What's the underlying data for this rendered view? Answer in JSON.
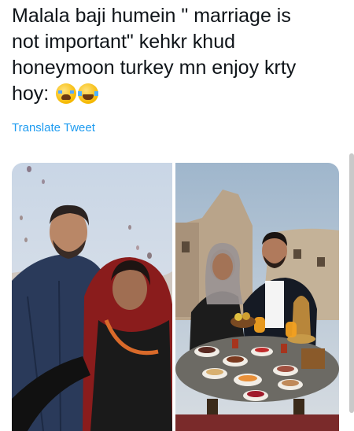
{
  "tweet": {
    "lines": [
      "Malala baji humein \" marriage is",
      "not important\" kehkr khud",
      "honeymoon turkey mn enjoy krty",
      "hoy:"
    ],
    "emojis": [
      "loudly-crying-face-emoji",
      "face-with-tears-of-joy-emoji"
    ]
  },
  "translate_link": "Translate Tweet",
  "media": {
    "left_photo": "couple-balloon-ride-photo",
    "right_photo": "couple-cappadocia-breakfast-photo"
  },
  "colors": {
    "text": "#0f1419",
    "link": "#1d9bf0"
  }
}
